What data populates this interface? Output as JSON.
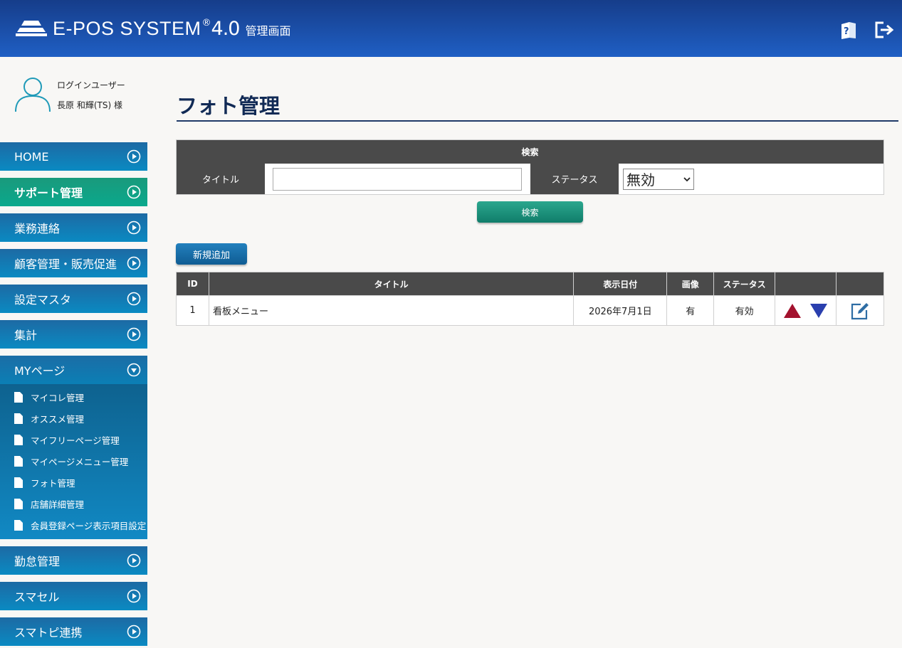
{
  "header": {
    "logo_name": "E-POS SYSTEM",
    "logo_reg": "®",
    "logo_version": "4.0",
    "logo_subtitle": "管理画面",
    "icons": [
      "help-book-icon",
      "logout-icon"
    ]
  },
  "user": {
    "label": "ログインユーザー",
    "name": "長原 和輝(TS) 様"
  },
  "sidebar": {
    "items": [
      {
        "label": "HOME"
      },
      {
        "label": "サポート管理"
      },
      {
        "label": "業務連絡"
      },
      {
        "label": "顧客管理・販売促進"
      },
      {
        "label": "設定マスタ"
      },
      {
        "label": "集計"
      },
      {
        "label": "MYページ"
      },
      {
        "label": "勤怠管理"
      },
      {
        "label": "スマセル"
      },
      {
        "label": "スマトピ連携"
      }
    ],
    "subitems": [
      {
        "label": "マイコレ管理"
      },
      {
        "label": "オススメ管理"
      },
      {
        "label": "マイフリーページ管理"
      },
      {
        "label": "マイページメニュー管理"
      },
      {
        "label": "フォト管理"
      },
      {
        "label": "店舗詳細管理"
      },
      {
        "label": "会員登録ページ表示項目設定"
      }
    ]
  },
  "page": {
    "title": "フォト管理"
  },
  "search": {
    "header": "検索",
    "title_label": "タイトル",
    "title_value": "",
    "status_label": "ステータス",
    "status_value": "無効",
    "button": "検索"
  },
  "actions": {
    "add_button": "新規追加"
  },
  "table": {
    "columns": [
      "ID",
      "タイトル",
      "表示日付",
      "画像",
      "ステータス",
      "",
      ""
    ],
    "rows": [
      {
        "id": "1",
        "title": "看板メニュー",
        "date": "2026年7月1日",
        "image": "有",
        "status": "有効"
      }
    ]
  },
  "colors": {
    "header_bg": "#1a4ea8",
    "nav_bg": "#0a7bb5",
    "nav_active_bg": "#11a386",
    "up_arrow": "#a3122e",
    "down_arrow": "#2a3fae",
    "edit_icon": "#2e6da4"
  }
}
